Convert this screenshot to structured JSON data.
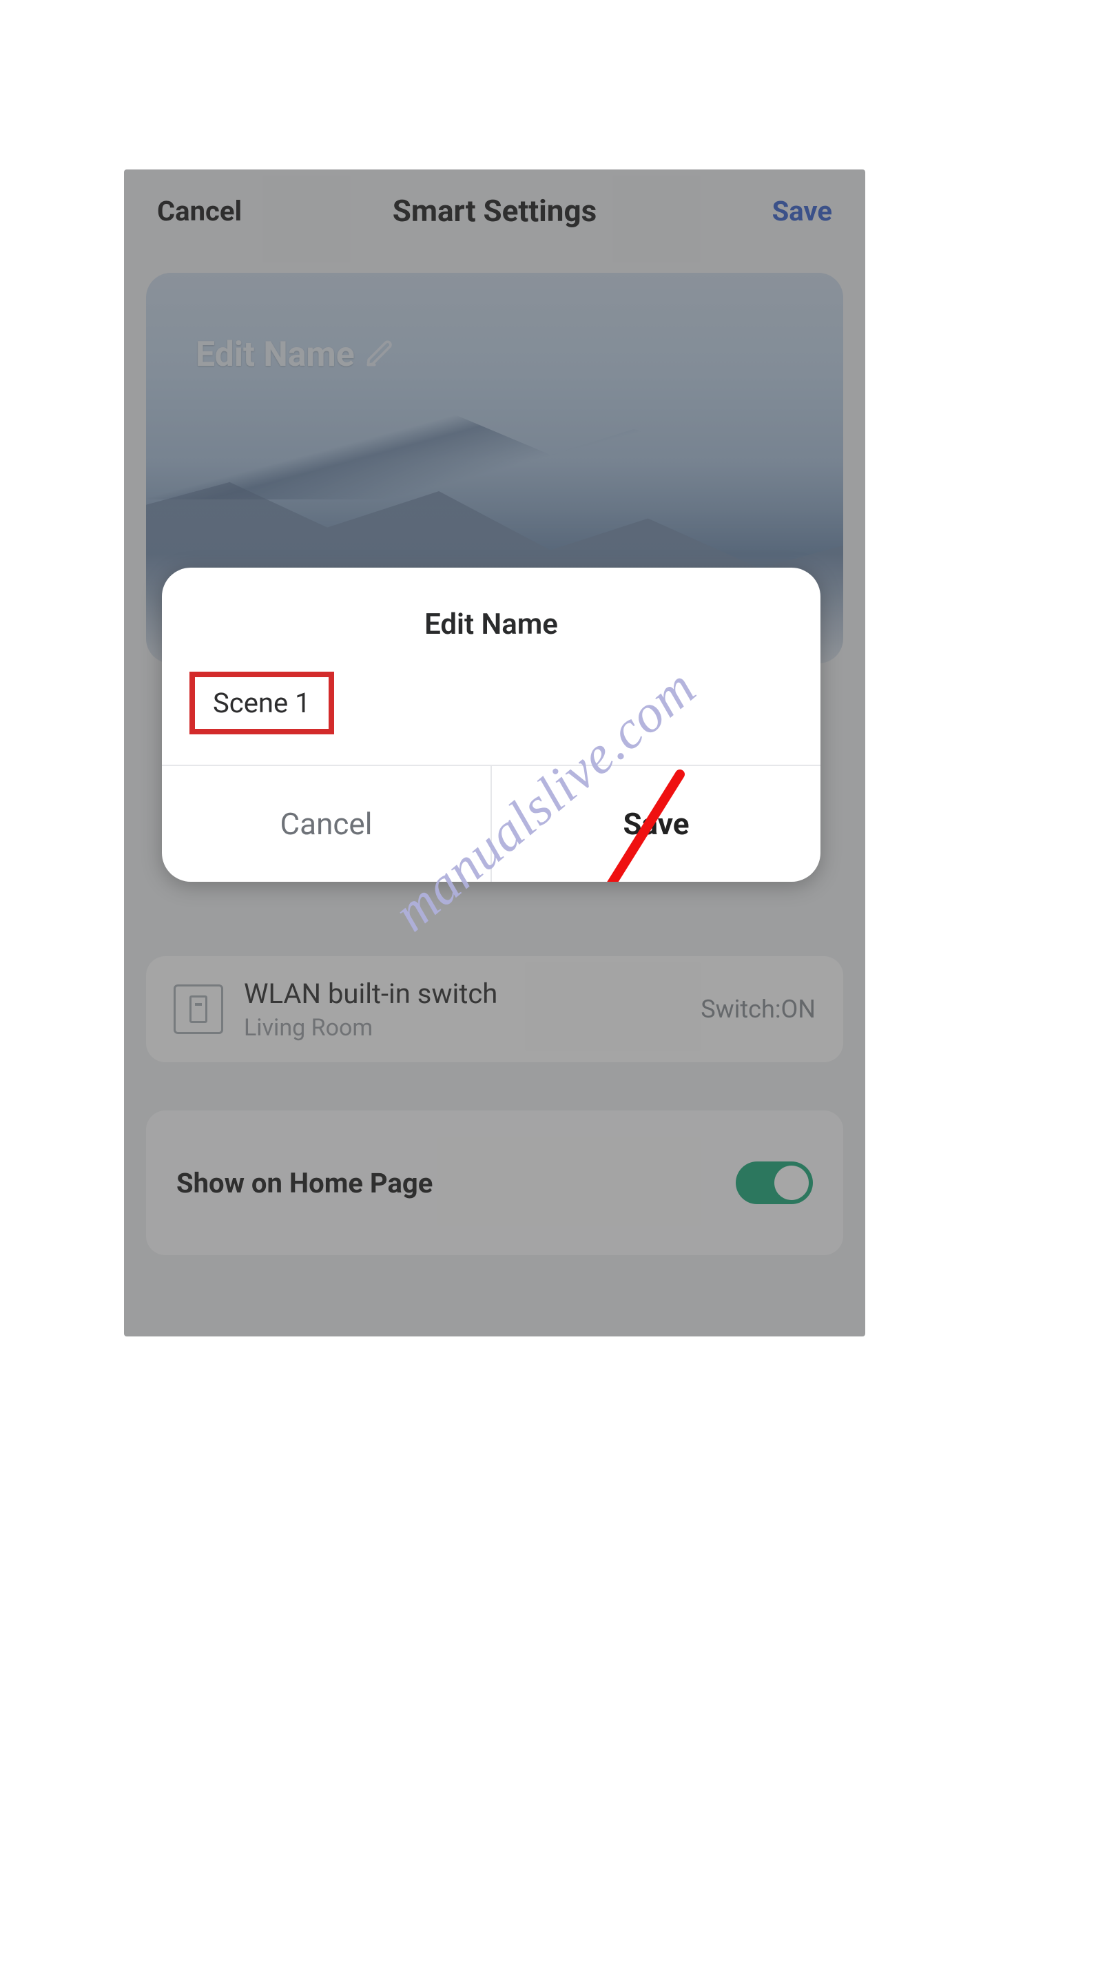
{
  "header": {
    "cancel_label": "Cancel",
    "title": "Smart Settings",
    "save_label": "Save"
  },
  "hero": {
    "edit_label": "Edit Name"
  },
  "device": {
    "name": "WLAN built-in switch",
    "room": "Living Room",
    "status": "Switch:ON"
  },
  "home_row": {
    "label": "Show on Home Page",
    "toggle_on": true
  },
  "modal": {
    "title": "Edit Name",
    "input_value": "Scene 1",
    "cancel_label": "Cancel",
    "save_label": "Save"
  },
  "watermark_text": "manualslive.com",
  "highlight": {
    "color": "#d32b2b",
    "target": "modal-input"
  },
  "arrow_color": "#ef1010",
  "accent": {
    "save_link": "#3a62c9",
    "toggle_on": "#1fa97a"
  }
}
